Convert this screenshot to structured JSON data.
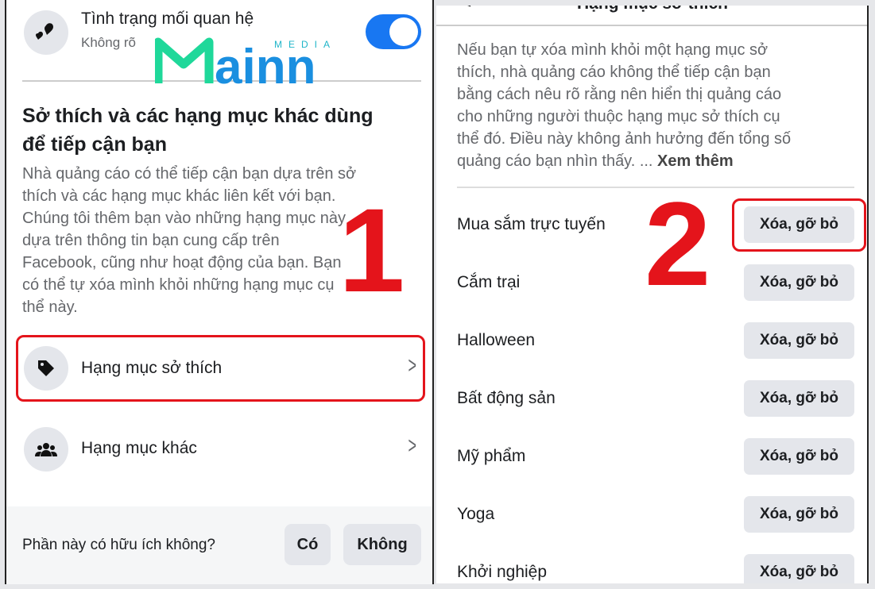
{
  "left": {
    "relationship": {
      "title": "Tình trạng mối quan hệ",
      "value": "Không rõ",
      "toggle_on": true,
      "icon": "hearts-icon"
    },
    "section_title_1": "Sở thích và các hạng mục khác dùng",
    "section_title_2": "để tiếp cận bạn",
    "description": [
      "Nhà quảng cáo có thể tiếp cận bạn dựa trên sở",
      "thích và các hạng mục khác liên kết với bạn.",
      "Chúng tôi thêm bạn vào những hạng mục này",
      "dựa trên thông tin bạn cung cấp trên",
      "Facebook, cũng như hoạt động của bạn. Bạn",
      "có thể tự xóa mình khỏi những hạng mục cụ",
      "thể này."
    ],
    "items": [
      {
        "label": "Hạng mục sở thích",
        "icon": "tag-icon"
      },
      {
        "label": "Hạng mục khác",
        "icon": "people-icon"
      }
    ],
    "feedback": {
      "question": "Phần này có hữu ích không?",
      "yes": "Có",
      "no": "Không"
    },
    "step": "1"
  },
  "logo": {
    "text": "Mainn",
    "sub": "MEDIA"
  },
  "right": {
    "header": "Hạng mục sở thích",
    "description": [
      "Nếu bạn tự xóa mình khỏi một hạng mục sở",
      "thích, nhà quảng cáo không thể tiếp cận bạn",
      "bằng cách nêu rõ rằng nên hiển thị quảng cáo",
      "cho những người thuộc hạng mục sở thích cụ",
      "thể đó. Điều này không ảnh hưởng đến tổng số",
      "quảng cáo bạn nhìn thấy. ... "
    ],
    "see_more": "Xem thêm",
    "remove_label": "Xóa, gỡ bỏ",
    "categories": [
      "Mua sắm trực tuyến",
      "Cắm trại",
      "Halloween",
      "Bất động sản",
      "Mỹ phẩm",
      "Yoga",
      "Khởi nghiệp"
    ],
    "step": "2"
  },
  "colors": {
    "accent": "#1877f2",
    "highlight": "#e4141b",
    "logo_green": "#1fd89a",
    "logo_blue": "#1a8fe0"
  }
}
